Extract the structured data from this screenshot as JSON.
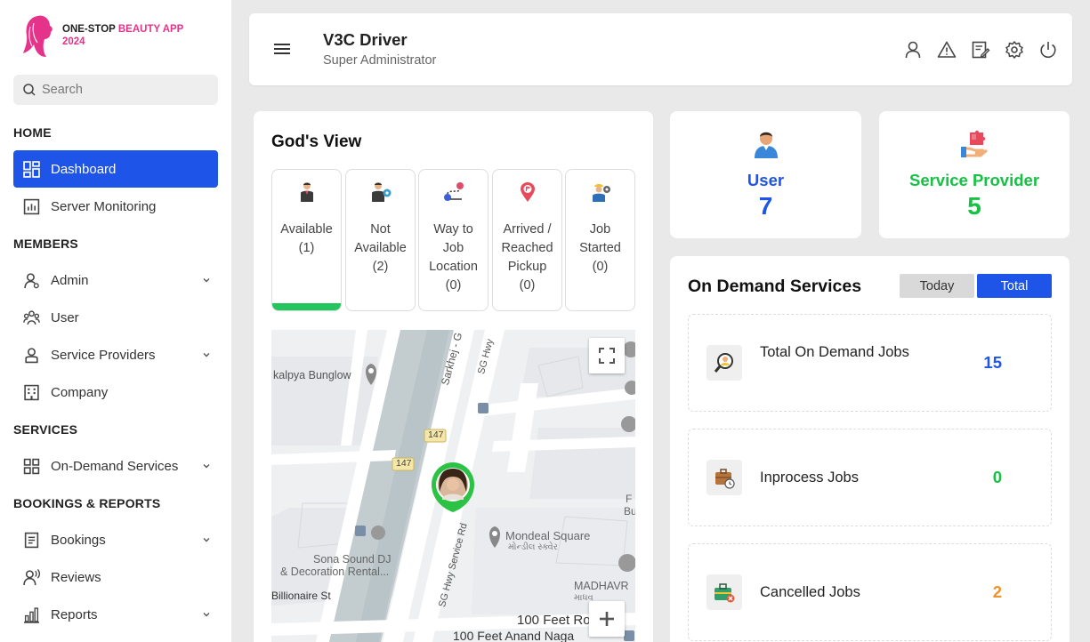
{
  "brand": {
    "line1": "ONE-STOP",
    "line1b": "BEAUTY APP",
    "line2": "2024"
  },
  "search": {
    "placeholder": "Search"
  },
  "sidebar": {
    "sections": {
      "home": "HOME",
      "members": "MEMBERS",
      "services": "SERVICES",
      "bookings": "BOOKINGS & REPORTS"
    },
    "items": {
      "dashboard": "Dashboard",
      "server_monitoring": "Server Monitoring",
      "admin": "Admin",
      "user": "User",
      "service_providers": "Service Providers",
      "company": "Company",
      "on_demand": "On-Demand Services",
      "bookings": "Bookings",
      "reviews": "Reviews",
      "reports": "Reports"
    }
  },
  "header": {
    "title": "V3C Driver",
    "subtitle": "Super Administrator"
  },
  "gods_view": {
    "title": "God's View",
    "statuses": [
      {
        "lines": [
          "Available"
        ],
        "count": "(1)"
      },
      {
        "lines": [
          "Not",
          "Available"
        ],
        "count": "(2)"
      },
      {
        "lines": [
          "Way to",
          "Job",
          "Location"
        ],
        "count": "(0)"
      },
      {
        "lines": [
          "Arrived /",
          "Reached",
          "Pickup"
        ],
        "count": "(0)"
      },
      {
        "lines": [
          "Job",
          "Started"
        ],
        "count": "(0)"
      }
    ],
    "map_labels": {
      "kalpya": "kalpya Bunglow",
      "sarkhej": "Sarkhej - G",
      "sghwy": "SG Hwy",
      "r147a": "147",
      "r147b": "147",
      "mondeal": "Mondeal Square",
      "mondeal_gu": "મોન્ડીલ સ્ક્વેર",
      "sona1": "Sona Sound DJ",
      "sona2": "& Decoration Rental...",
      "sgservice": "SG Hwy Service Rd",
      "illionaire": "Billionaire St",
      "madhav": "MADHAVR",
      "madhav_gu": "માધવ",
      "feet1": "100 Feet Ro",
      "feet2": "100 Feet Anand Naga",
      "fbu1": "F",
      "fbu2": "Bu"
    }
  },
  "stats": {
    "user": {
      "label": "User",
      "value": "7",
      "color": "#1f54e8"
    },
    "provider": {
      "label": "Service Provider",
      "value": "5",
      "color": "#16c143"
    }
  },
  "on_demand": {
    "title": "On Demand Services",
    "today": "Today",
    "total": "Total",
    "rows": [
      {
        "label": "Total On Demand Jobs",
        "value": "15",
        "color": "#1f54e8",
        "icon": "search-person-icon"
      },
      {
        "label": "Inprocess Jobs",
        "value": "0",
        "color": "#16c143",
        "icon": "briefcase-clock-icon"
      },
      {
        "label": "Cancelled Jobs",
        "value": "2",
        "color": "#f0922b",
        "icon": "briefcase-cancel-icon"
      }
    ]
  }
}
